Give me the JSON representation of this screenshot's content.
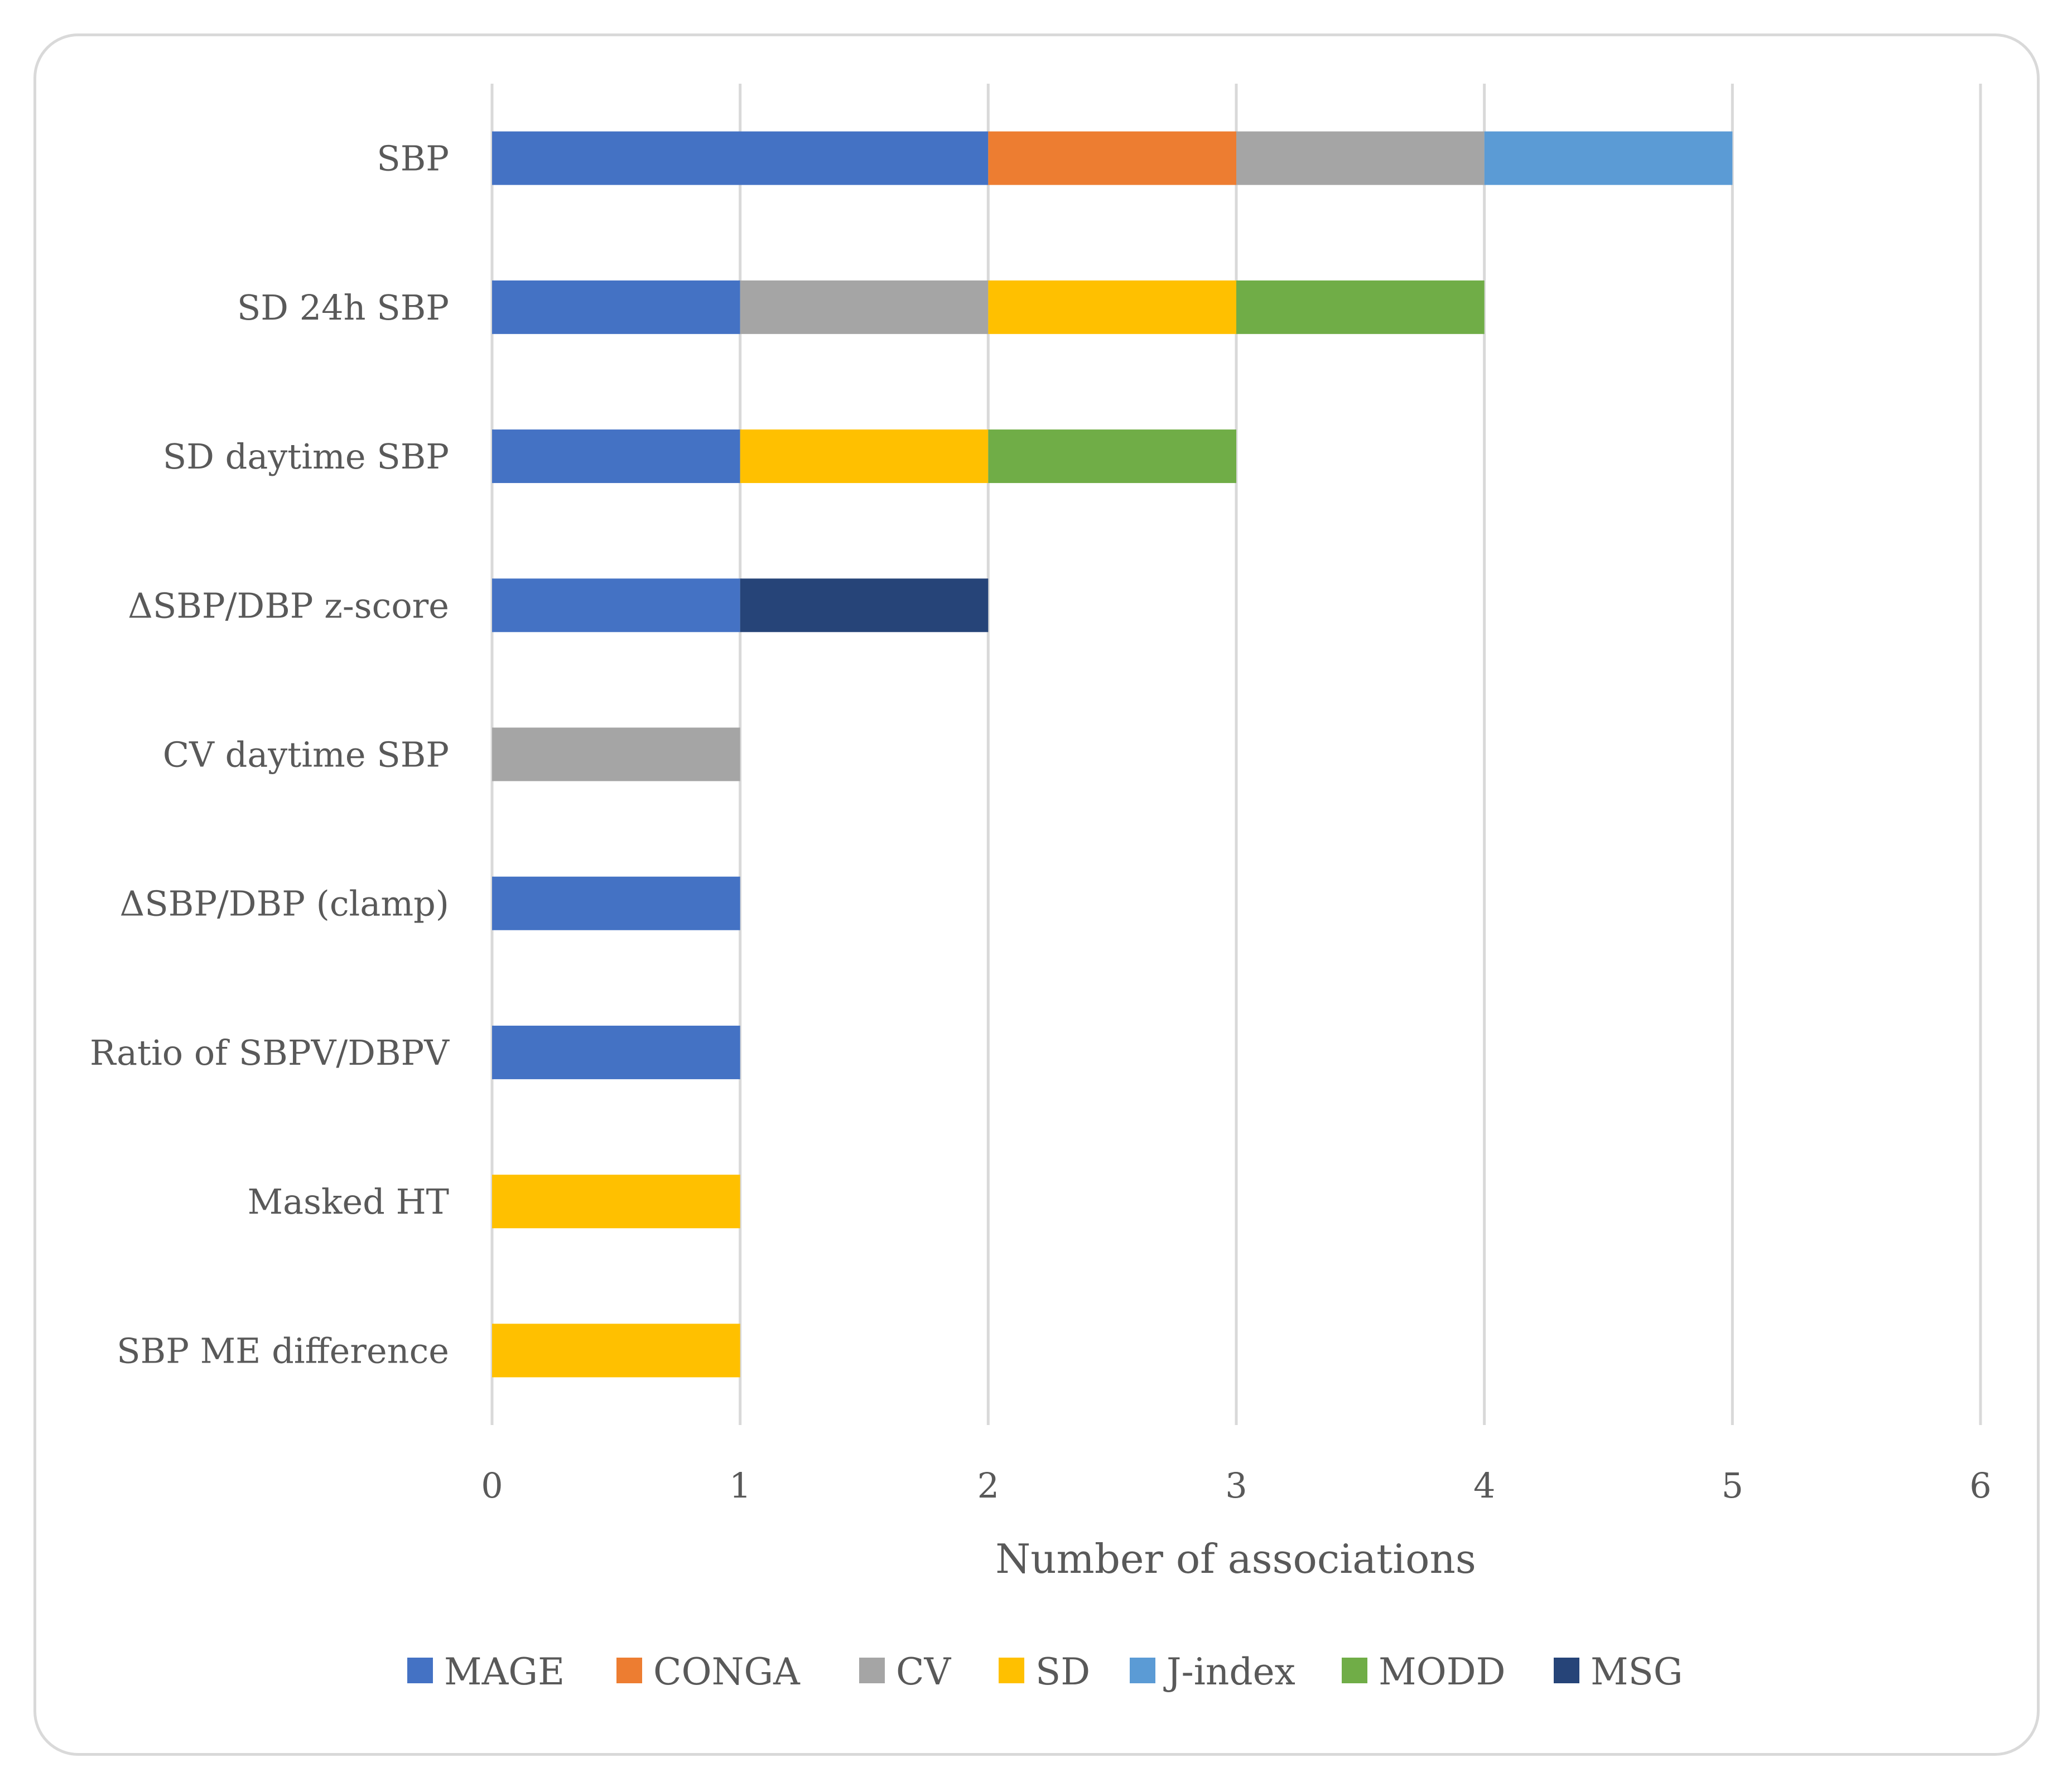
{
  "chart_data": {
    "type": "bar",
    "orientation": "horizontal",
    "stacked": true,
    "title": "",
    "xlabel": "Number of associations",
    "ylabel": "",
    "xlim": [
      0,
      6
    ],
    "xticks": [
      "0",
      "1",
      "2",
      "3",
      "4",
      "5",
      "6"
    ],
    "grid": true,
    "legend_position": "bottom",
    "categories": [
      "SBP",
      "SD 24h SBP",
      "SD daytime SBP",
      "ΔSBP/DBP z-score",
      "CV daytime SBP",
      "ΔSBP/DBP (clamp)",
      "Ratio of SBPV/DBPV",
      "Masked HT",
      "SBP ME difference"
    ],
    "series": [
      {
        "name": "MAGE",
        "color": "#4472c4",
        "values": [
          2,
          1,
          1,
          1,
          0,
          1,
          1,
          0,
          0
        ]
      },
      {
        "name": "CONGA",
        "color": "#ed7d31",
        "values": [
          1,
          0,
          0,
          0,
          0,
          0,
          0,
          0,
          0
        ]
      },
      {
        "name": "CV",
        "color": "#a5a5a5",
        "values": [
          1,
          1,
          0,
          0,
          1,
          0,
          0,
          0,
          0
        ]
      },
      {
        "name": "SD",
        "color": "#ffc000",
        "values": [
          0,
          1,
          1,
          0,
          0,
          0,
          0,
          1,
          1
        ]
      },
      {
        "name": "J-index",
        "color": "#5b9bd5",
        "values": [
          1,
          0,
          0,
          0,
          0,
          0,
          0,
          0,
          0
        ]
      },
      {
        "name": "MODD",
        "color": "#70ad47",
        "values": [
          0,
          1,
          1,
          0,
          0,
          0,
          0,
          0,
          0
        ]
      },
      {
        "name": "MSG",
        "color": "#264478",
        "values": [
          0,
          0,
          0,
          1,
          0,
          0,
          0,
          0,
          0
        ]
      }
    ]
  }
}
